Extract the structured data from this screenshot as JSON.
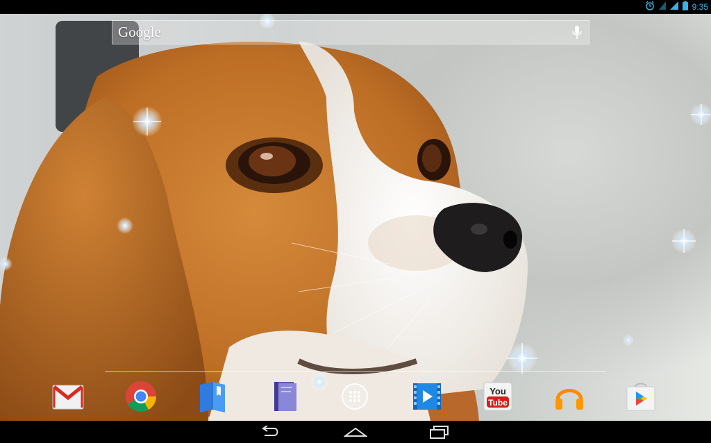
{
  "status_bar": {
    "time": "9:35",
    "icons": [
      "alarm-icon",
      "wifi-icon",
      "signal-icon",
      "battery-icon"
    ]
  },
  "search": {
    "logo_text": "Google",
    "icon": "microphone-icon"
  },
  "dock": {
    "apps": [
      {
        "name": "Gmail",
        "icon": "gmail-icon"
      },
      {
        "name": "Chrome",
        "icon": "chrome-icon"
      },
      {
        "name": "Play Books",
        "icon": "play-books-icon"
      },
      {
        "name": "Play Books Library",
        "icon": "book-icon"
      },
      {
        "name": "All Apps",
        "icon": "app-drawer-icon"
      },
      {
        "name": "Play Movies",
        "icon": "play-movies-icon"
      },
      {
        "name": "YouTube",
        "icon": "youtube-icon"
      },
      {
        "name": "Play Music",
        "icon": "headphones-icon"
      },
      {
        "name": "Play Store",
        "icon": "play-store-icon"
      }
    ],
    "youtube_label_top": "You",
    "youtube_label_bottom": "Tube"
  },
  "nav_bar": {
    "buttons": [
      "back-icon",
      "home-icon",
      "recents-icon"
    ]
  },
  "wallpaper": {
    "subject": "beagle dog portrait",
    "colors": {
      "fur": "#c8782c",
      "white": "#f2ece4",
      "nose": "#1e1c1d",
      "background": "#c7cbc9"
    }
  }
}
